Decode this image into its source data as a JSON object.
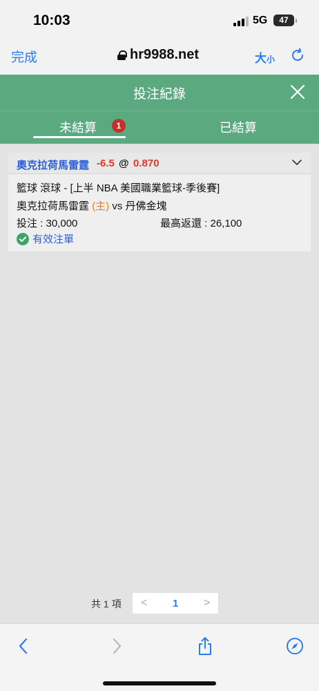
{
  "status_bar": {
    "time": "10:03",
    "network": "5G",
    "battery": "47"
  },
  "browser": {
    "done_label": "完成",
    "url": "hr9988.net",
    "text_size_big": "大",
    "text_size_small": "小"
  },
  "header": {
    "title": "投注紀錄"
  },
  "tabs": {
    "unsettled_label": "未結算",
    "unsettled_count": "1",
    "settled_label": "已結算",
    "active": "unsettled"
  },
  "bet": {
    "team": "奧克拉荷馬雷霆",
    "handicap": "-6.5",
    "at": "@",
    "odds": "0.870",
    "league_line": "籃球 滾球 - [上半 NBA 美國職業籃球-季後賽]",
    "home_team": "奧克拉荷馬雷霆",
    "home_marker": "(主)",
    "vs": "vs",
    "away_team": "丹佛金塊",
    "stake": "投注 : 30,000",
    "max_return": "最高返還 : 26,100",
    "status": "有效注單"
  },
  "pagination": {
    "total": "共 1 項",
    "prev": "<",
    "page": "1",
    "next": ">"
  },
  "colors": {
    "header_green": "#5aa97f",
    "link_blue": "#2b5fd9",
    "odds_red": "#d93a2b",
    "badge_red": "#c4302b",
    "home_orange": "#e8801e"
  }
}
